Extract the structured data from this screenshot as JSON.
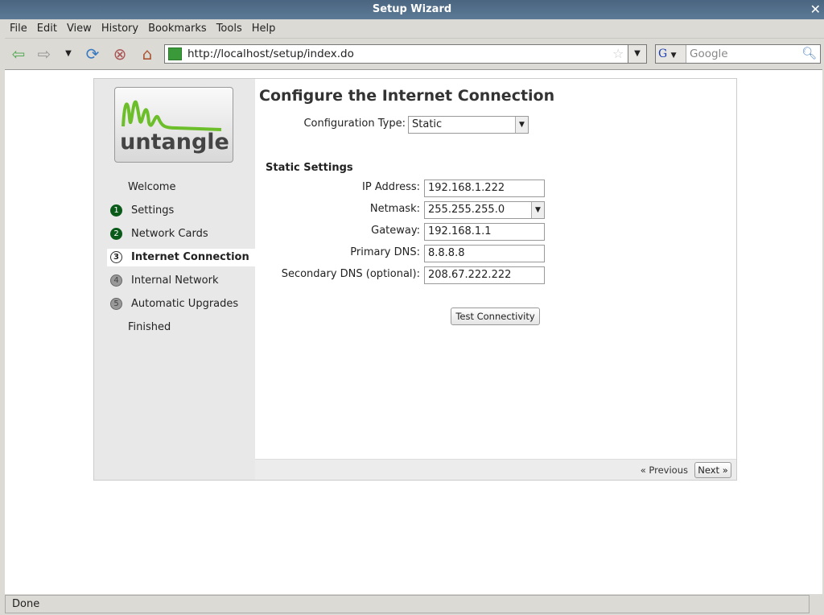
{
  "window": {
    "title": "Setup Wizard"
  },
  "menu": [
    "File",
    "Edit",
    "View",
    "History",
    "Bookmarks",
    "Tools",
    "Help"
  ],
  "urlbar": {
    "value": "http://localhost/setup/index.do"
  },
  "search": {
    "placeholder": "Google"
  },
  "logo": {
    "text": "untangle"
  },
  "steps": [
    {
      "num": "",
      "label": "Welcome",
      "state": "plain"
    },
    {
      "num": "1",
      "label": "Settings",
      "state": "done"
    },
    {
      "num": "2",
      "label": "Network Cards",
      "state": "done"
    },
    {
      "num": "3",
      "label": "Internet Connection",
      "state": "current"
    },
    {
      "num": "4",
      "label": "Internal Network",
      "state": "todo"
    },
    {
      "num": "5",
      "label": "Automatic Upgrades",
      "state": "todo"
    },
    {
      "num": "",
      "label": "Finished",
      "state": "plain"
    }
  ],
  "page": {
    "title": "Configure the Internet Connection",
    "config_type_label": "Configuration Type:",
    "config_type_value": "Static",
    "section": "Static Settings",
    "fields": [
      {
        "label": "IP Address:",
        "value": "192.168.1.222"
      },
      {
        "label": "Netmask:",
        "value": "255.255.255.0"
      },
      {
        "label": "Gateway:",
        "value": "192.168.1.1"
      },
      {
        "label": "Primary DNS:",
        "value": "8.8.8.8"
      },
      {
        "label": "Secondary DNS (optional):",
        "value": "208.67.222.222"
      }
    ],
    "test_button": "Test Connectivity",
    "previous": "« Previous",
    "next": "Next »"
  },
  "status": "Done"
}
